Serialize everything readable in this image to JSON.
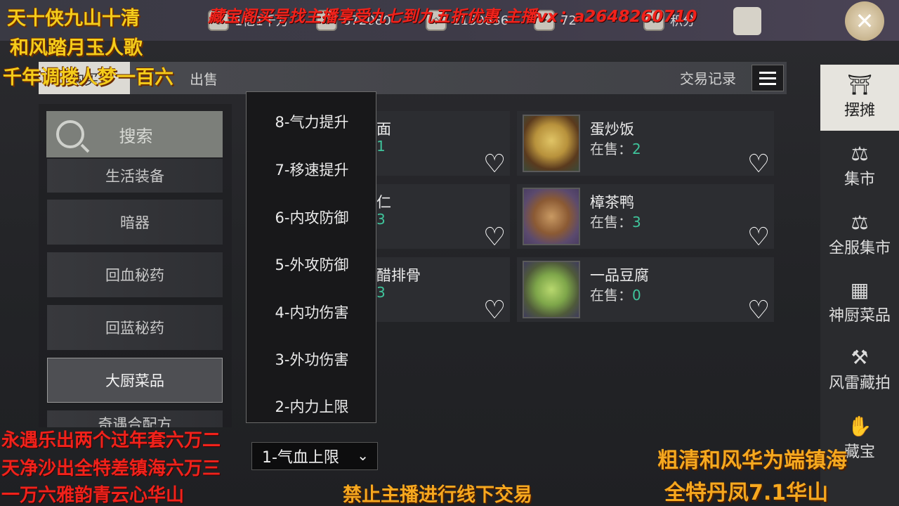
{
  "top_bar": {
    "resources": [
      {
        "icon": "coin-icon",
        "value": "1亿1千万"
      },
      {
        "icon": "ingot-icon",
        "value": "872080"
      },
      {
        "icon": "silver-icon",
        "value": "1159836"
      },
      {
        "icon": "ticket-icon",
        "value": "72"
      },
      {
        "icon": "points-icon",
        "value": "积分"
      }
    ]
  },
  "tabs": [
    {
      "label": "购买"
    },
    {
      "label": "出售"
    }
  ],
  "header": {
    "trade_record": "交易记录"
  },
  "search": {
    "label": "搜索"
  },
  "categories": [
    {
      "label": "生活装备"
    },
    {
      "label": "暗器"
    },
    {
      "label": "回血秘药"
    },
    {
      "label": "回蓝秘药"
    },
    {
      "label": "大厨菜品"
    },
    {
      "label": "奇遇合配方"
    }
  ],
  "items": [
    {
      "name": "面",
      "sale_label": "",
      "sale_count": "1"
    },
    {
      "name": "蛋炒饭",
      "sale_label": "在售：",
      "sale_count": "2"
    },
    {
      "name": "仁",
      "sale_label": "",
      "sale_count": "3"
    },
    {
      "name": "樟茶鸭",
      "sale_label": "在售：",
      "sale_count": "3"
    },
    {
      "name": "醋排骨",
      "sale_label": "",
      "sale_count": "3"
    },
    {
      "name": "一品豆腐",
      "sale_label": "在售：",
      "sale_count": "0"
    }
  ],
  "dropdown": {
    "options": [
      "8-气力提升",
      "7-移速提升",
      "6-内攻防御",
      "5-外攻防御",
      "4-内功伤害",
      "3-外功伤害",
      "2-内力上限"
    ],
    "selected": "1-气血上限"
  },
  "right_nav": [
    {
      "label": "摆摊",
      "icon": "stall-icon"
    },
    {
      "label": "集市",
      "icon": "scale-icon"
    },
    {
      "label": "全服集市",
      "icon": "scale-icon"
    },
    {
      "label": "神厨菜品",
      "icon": "kitchen-icon"
    },
    {
      "label": "风雷藏拍",
      "icon": "gavel-icon"
    },
    {
      "label": "藏宝",
      "icon": "treasure-icon"
    }
  ],
  "overlay": {
    "top_left": [
      "天十侠九山十清",
      "和风踏月玉人歌",
      "千年调搂人梦一百六"
    ],
    "top_banner": "藏宝阁买号找主播享受九七到九五折优惠 主播vx：a2648260710",
    "bottom_left": [
      "永遇乐出两个过年套六万二",
      "天净沙出全特差镇海六万三",
      "一万六雅韵青云心华山"
    ],
    "bottom_center": "禁止主播进行线下交易",
    "bottom_right": [
      "粗清和风华为端镇海",
      "全特丹凤7.1华山"
    ]
  },
  "colors": {
    "sale_count": "#3fc49b",
    "overlay_gold": "#f4cc1b",
    "overlay_red": "#f0221b"
  }
}
